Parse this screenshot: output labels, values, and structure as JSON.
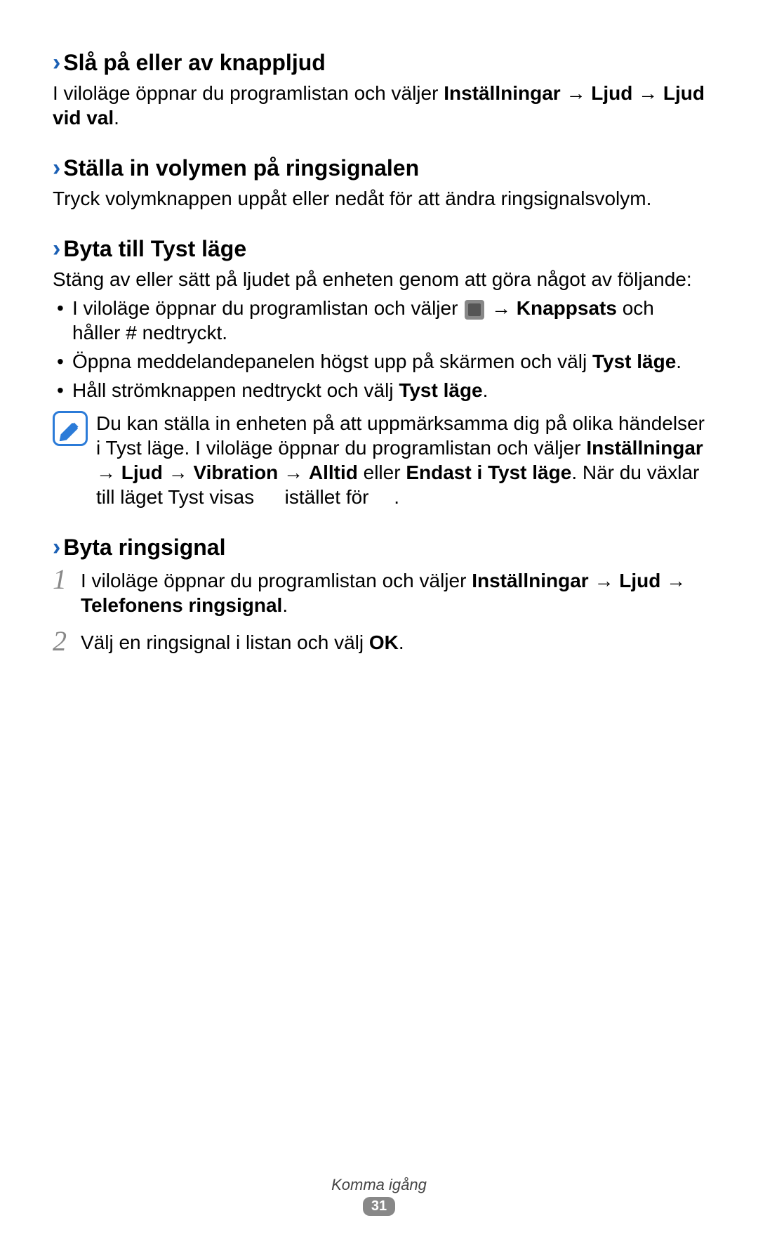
{
  "sections": {
    "s1": {
      "heading": "Slå på eller av knappljud",
      "p1_a": "I viloläge öppnar du programlistan och väljer ",
      "p1_b": "Inställningar",
      "p1_arrow1": " → ",
      "p1_c": "Ljud",
      "p1_arrow2": " → ",
      "p1_d": "Ljud vid val",
      "p1_end": "."
    },
    "s2": {
      "heading": "Ställa in volymen på ringsignalen",
      "p1": "Tryck volymknappen uppåt eller nedåt för att ändra ringsignalsvolym."
    },
    "s3": {
      "heading": "Byta till Tyst läge",
      "p1": "Stäng av eller sätt på ljudet på enheten genom att göra något av följande:",
      "b1_a": "I viloläge öppnar du programlistan och väljer ",
      "b1_arrow": " → ",
      "b1_b": "Knappsats",
      "b1_c": " och håller ",
      "b1_hash": "#",
      "b1_d": " nedtryckt.",
      "b2_a": "Öppna meddelandepanelen högst upp på skärmen och välj ",
      "b2_b": "Tyst läge",
      "b2_end": ".",
      "b3_a": "Håll strömknappen nedtryckt och välj ",
      "b3_b": "Tyst läge",
      "b3_end": ".",
      "note_a": "Du kan ställa in enheten på att uppmärksamma dig på olika händelser i Tyst läge. I viloläge öppnar du programlistan och väljer ",
      "note_b": "Inställningar",
      "note_arrow1": " → ",
      "note_c": "Ljud",
      "note_arrow2": " → ",
      "note_d": "Vibration",
      "note_arrow3": " → ",
      "note_e": "Alltid",
      "note_f": " eller ",
      "note_g": "Endast i Tyst läge",
      "note_h": ". När du växlar till läget Tyst visas ",
      "note_i": " istället för ",
      "note_end": "."
    },
    "s4": {
      "heading": "Byta ringsignal",
      "step1_num": "1",
      "step1_a": "I viloläge öppnar du programlistan och väljer ",
      "step1_b": "Inställningar",
      "step1_arrow1": " → ",
      "step1_c": "Ljud",
      "step1_arrow2": " → ",
      "step1_d": "Telefonens ringsignal",
      "step1_end": ".",
      "step2_num": "2",
      "step2_a": "Välj en ringsignal i listan och välj ",
      "step2_b": "OK",
      "step2_end": "."
    }
  },
  "footer": {
    "title": "Komma igång",
    "page": "31"
  }
}
